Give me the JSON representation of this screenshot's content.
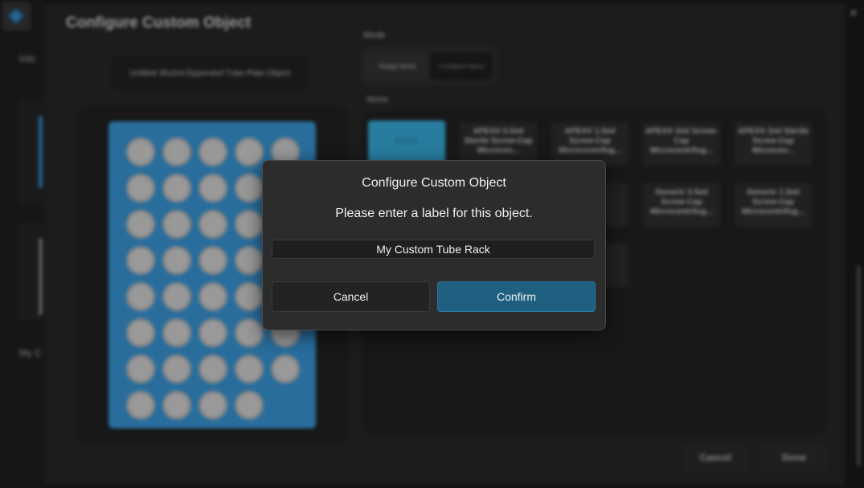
{
  "colors": {
    "accent": "#1f5f80",
    "plate_blue": "#3ea8f0",
    "selected_item": "#3ec0f5",
    "background": "#1c1c1c"
  },
  "app": {
    "left_sidebar": {
      "text_1": "Inte",
      "text_2": "My C"
    },
    "close_icon": "close-icon"
  },
  "editor": {
    "title": "Configure Custom Object",
    "object_name": "Untitled 35x2ml Eppendorf Tube Plate Object",
    "mode_label": "Mode",
    "mode_options": [
      "Assign Items",
      "Configure Items"
    ],
    "items_label": "Items",
    "items": [
      "Delete",
      "APEX® 0.5ml Sterile Screw-Cap Microcen...",
      "APEX® 1.5ml Screw-Cap Microcentrifug...",
      "APEX® 2ml Screw-Cap Microcentrifug...",
      "APEX® 2ml Sterile Screw-Cap Microcen...",
      "Generic 0.5ml Screw-Cap Microcentrifug...",
      "Generic 1.5ml Screw-Cap Microcentrifug..."
    ],
    "cancel_label": "Cancel",
    "done_label": "Done"
  },
  "dialog": {
    "title": "Configure Custom Object",
    "message": "Please enter a label for this object.",
    "input_value": "My Custom Tube Rack",
    "cancel_label": "Cancel",
    "confirm_label": "Confirm"
  }
}
